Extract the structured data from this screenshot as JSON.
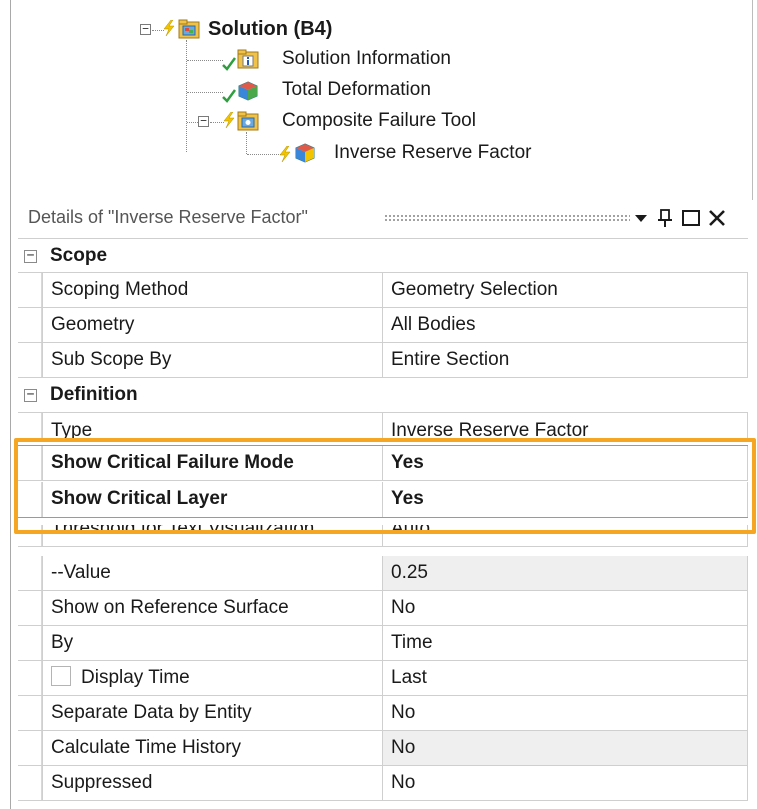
{
  "tree": {
    "solution_label": "Solution (B4)",
    "items": [
      {
        "label": "Solution Information"
      },
      {
        "label": "Total Deformation"
      },
      {
        "label": "Composite Failure Tool"
      },
      {
        "label": "Inverse Reserve Factor"
      }
    ],
    "expander_symbol": "⊟",
    "collapse_symbol": "−"
  },
  "details": {
    "title": "Details of \"Inverse Reserve Factor\"",
    "buttons": {
      "dropdown": "▾",
      "pin": "pin-icon",
      "maximize": "maximize-icon",
      "close": "×"
    }
  },
  "categories": {
    "scope": "Scope",
    "definition": "Definition",
    "expander": "−"
  },
  "properties": {
    "scoping_method": {
      "name": "Scoping Method",
      "value": "Geometry Selection"
    },
    "geometry": {
      "name": "Geometry",
      "value": "All Bodies"
    },
    "sub_scope_by": {
      "name": "Sub Scope By",
      "value": "Entire Section"
    },
    "type": {
      "name": "Type",
      "value": "Inverse Reserve Factor"
    },
    "show_critical_failure_mode": {
      "name": "Show Critical Failure Mode",
      "value": "Yes"
    },
    "show_critical_layer": {
      "name": "Show Critical Layer",
      "value": "Yes"
    },
    "threshold": {
      "name": "Threshold for Text Visualization",
      "value": "Auto"
    },
    "value": {
      "name": "--Value",
      "value": "0.25"
    },
    "show_on_reference_surface": {
      "name": "Show on Reference Surface",
      "value": "No"
    },
    "by": {
      "name": "By",
      "value": "Time"
    },
    "display_time": {
      "name": "Display Time",
      "value": "Last"
    },
    "separate_data_by_entity": {
      "name": "Separate Data by Entity",
      "value": "No"
    },
    "calculate_time_history": {
      "name": "Calculate Time History",
      "value": "No"
    },
    "suppressed": {
      "name": "Suppressed",
      "value": "No"
    }
  },
  "colors": {
    "highlight": "#f5a623",
    "check_green": "#2e9e3e",
    "lightning_yellow": "#f2c400",
    "folder_yellow": "#f0c24a"
  }
}
